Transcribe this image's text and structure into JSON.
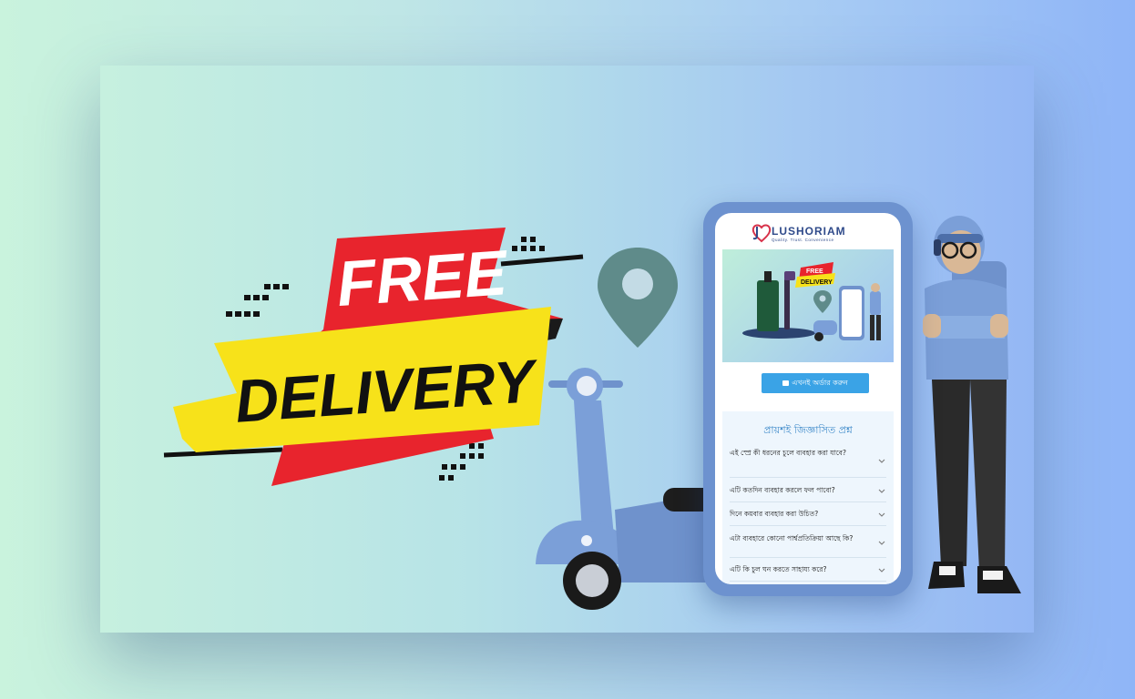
{
  "banner": {
    "free": "FREE",
    "delivery": "DELIVERY"
  },
  "phone": {
    "brand": "LUSHORIAM",
    "tagline": "Quality. Trust. Convenience",
    "hero_free": "FREE",
    "hero_delivery": "DELIVERY",
    "order_button": "এখনই অর্ডার করুন",
    "faq_title": "প্রায়শই জিজ্ঞাসিত প্রশ্ন",
    "faq_items": [
      "এই স্প্রে কী ধরনের চুলে ব্যবহার করা যাবে?",
      "এটি কতদিন ব্যবহার করলে ফল পাবো?",
      "দিনে কয়বার ব্যবহার করা উচিত?",
      "এটা ব্যবহারে কোনো পার্শ্বপ্রতিক্রিয়া আছে কি?",
      "এটি কি চুল ঘন করতে সাহায্য করে?"
    ]
  },
  "colors": {
    "ribbon_yellow": "#f7e21a",
    "ribbon_red": "#e8242d",
    "scooter_blue": "#7b9fd8",
    "pin_teal": "#5f8b8a",
    "accent_blue": "#3aa3e6"
  },
  "icons": [
    "location-pin-icon",
    "scooter-illustration",
    "delivery-man-illustration",
    "cart-icon",
    "chevron-down-icon"
  ]
}
